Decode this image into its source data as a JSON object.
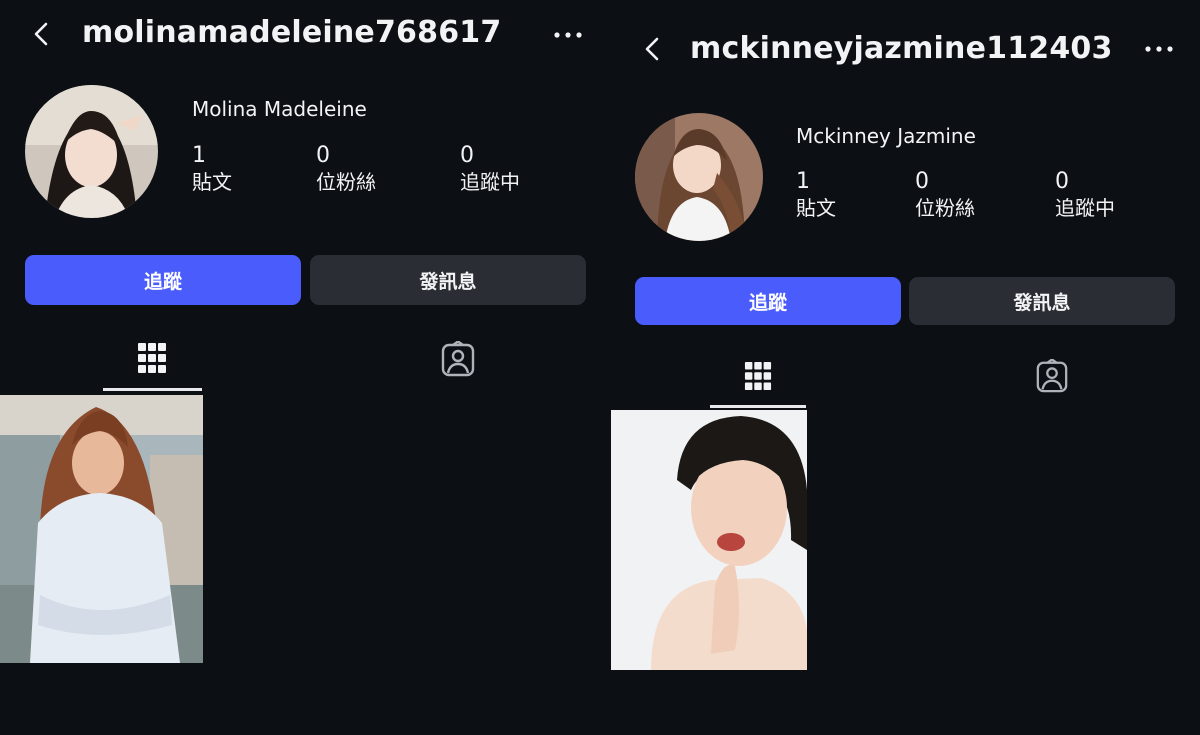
{
  "colors": {
    "background": "#0c0f14",
    "follow_button": "#4a5dfc",
    "message_button": "#2a2d33",
    "text": "#f2f3f5"
  },
  "profiles": [
    {
      "username": "molinamadeleine768617",
      "display_name": "Molina Madeleine",
      "stats": [
        {
          "value": "1",
          "label": "貼文"
        },
        {
          "value": "0",
          "label": "位粉絲"
        },
        {
          "value": "0",
          "label": "追蹤中"
        }
      ],
      "follow_label": "追蹤",
      "message_label": "發訊息",
      "icons": {
        "back": "chevron-left-icon",
        "more": "more-horizontal-icon",
        "grid": "grid-icon",
        "tagged": "tagged-person-icon"
      }
    },
    {
      "username": "mckinneyjazmine112403",
      "display_name": "Mckinney Jazmine",
      "stats": [
        {
          "value": "1",
          "label": "貼文"
        },
        {
          "value": "0",
          "label": "位粉絲"
        },
        {
          "value": "0",
          "label": "追蹤中"
        }
      ],
      "follow_label": "追蹤",
      "message_label": "發訊息",
      "icons": {
        "back": "chevron-left-icon",
        "more": "more-horizontal-icon",
        "grid": "grid-icon",
        "tagged": "tagged-person-icon"
      }
    }
  ]
}
